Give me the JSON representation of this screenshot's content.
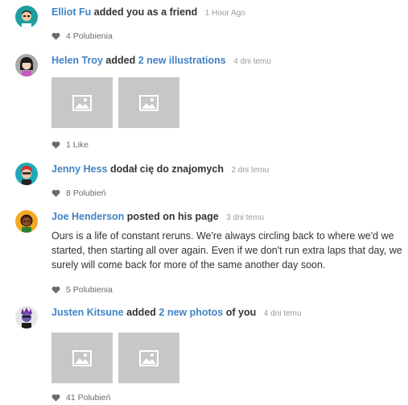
{
  "events": [
    {
      "user": "Elliot Fu",
      "action": "added you as a friend",
      "date": "1 Hour Ago",
      "likes": "4 Polubienia",
      "avatar_colors": {
        "bg": "#1f9e9e",
        "skin": "#f2c9a6",
        "hair": "#1c1c1c",
        "shirt": "#ffffff"
      }
    },
    {
      "user": "Helen Troy",
      "action_pre": "added",
      "link": "2 new illustrations",
      "date": "4 dni temu",
      "likes": "1 Like",
      "avatar_colors": {
        "bg": "#a9a9a9",
        "skin": "#f4d3bd",
        "hair": "#1a1a1a",
        "shirt": "#c15cc0"
      }
    },
    {
      "user": "Jenny Hess",
      "action": "dodał cię do znajomych",
      "date": "2 dni temu",
      "likes": "8 Polubień",
      "avatar_colors": {
        "bg": "#1ea9b7",
        "skin": "#f3c4a3",
        "hair": "#d9302a",
        "shirt": "#222222"
      }
    },
    {
      "user": "Joe Henderson",
      "action": "posted on his page",
      "date": "3 dni temu",
      "text": "Ours is a life of constant reruns. We're always circling back to where we'd we started, then starting all over again. Even if we don't run extra laps that day, we surely will come back for more of the same another day soon.",
      "likes": "5 Polubienia",
      "avatar_colors": {
        "bg": "#f4a823",
        "skin": "#8a4b2a",
        "hair": "#2b1a12",
        "shirt": "#2e7d32"
      }
    },
    {
      "user": "Justen Kitsune",
      "action_pre": "added",
      "link": "2 new photos",
      "action_post": "of you",
      "date": "4 dni temu",
      "likes": "41 Polubień",
      "avatar_colors": {
        "bg": "#e6e6e6",
        "skin": "#6c5fb3",
        "hair": "#6f2fa0",
        "shirt": "#1d1d1d"
      }
    }
  ],
  "colors": {
    "link": "#4183c4",
    "image_placeholder": "#c7c7c7",
    "meta": "#6b6b6b"
  }
}
